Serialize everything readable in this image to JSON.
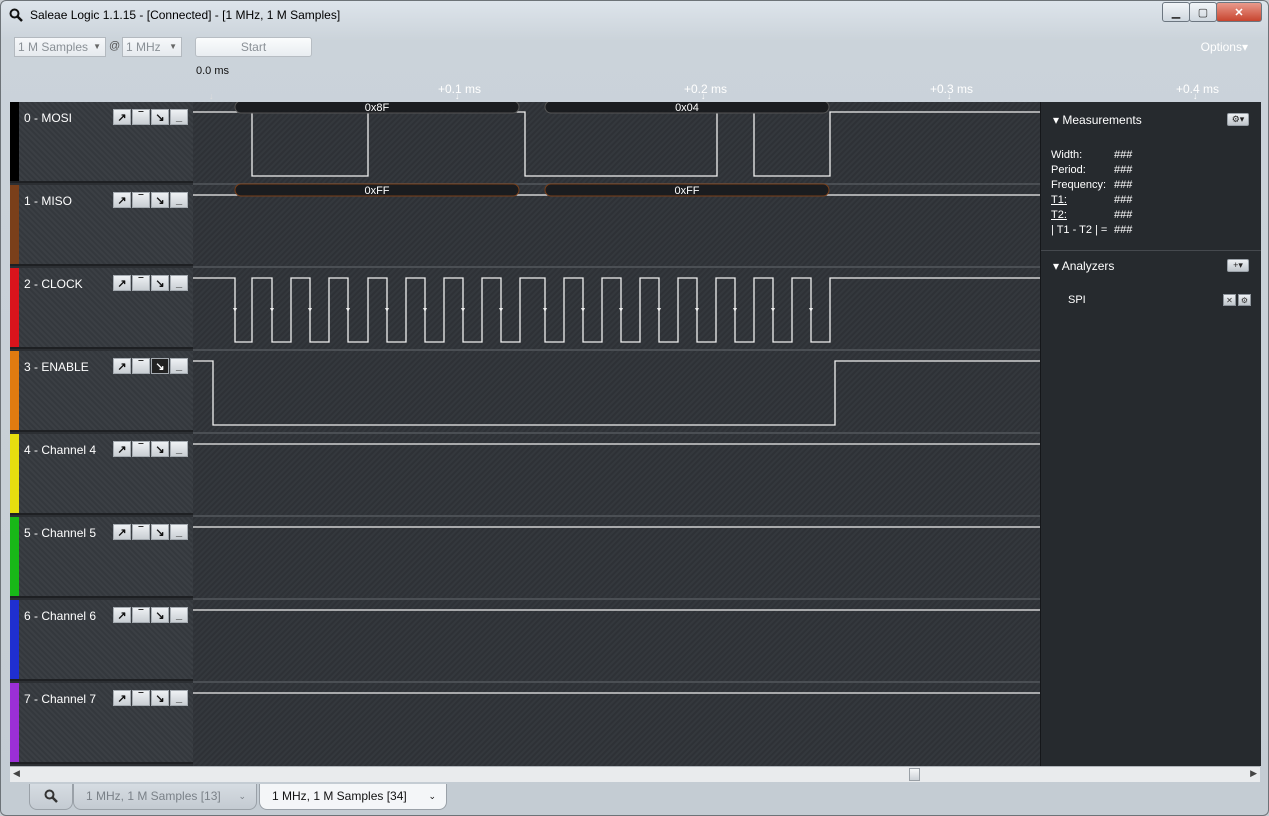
{
  "window": {
    "title": "Saleae Logic 1.1.15 - [Connected] - [1 MHz, 1 M Samples]",
    "minimize_icon": "minimize-icon",
    "maximize_icon": "maximize-icon",
    "close_icon": "close-icon"
  },
  "toolbar": {
    "samples_value": "1 M Samples",
    "at_symbol": "@",
    "rate_value": "1 MHz",
    "start_label": "Start",
    "options_label": "Options▾"
  },
  "timeline": {
    "origin_label": "0.0 ms",
    "ticks": [
      "+0.1 ms",
      "+0.2 ms",
      "+0.3 ms",
      "+0.4 ms"
    ]
  },
  "channels": [
    {
      "label": "0 - MOSI",
      "color": "#000000"
    },
    {
      "label": "1 - MISO",
      "color": "#7a3f1a"
    },
    {
      "label": "2 - CLOCK",
      "color": "#d9141c"
    },
    {
      "label": "3 - ENABLE",
      "color": "#e07b10"
    },
    {
      "label": "4 - Channel 4",
      "color": "#e6de0f"
    },
    {
      "label": "5 - Channel 5",
      "color": "#18b818"
    },
    {
      "label": "6 - Channel 6",
      "color": "#1f2fd0"
    },
    {
      "label": "7 - Channel 7",
      "color": "#9b2fd6"
    }
  ],
  "decoded": {
    "mosi": [
      "0x8F",
      "0x04"
    ],
    "miso": [
      "0xFF",
      "0xFF"
    ]
  },
  "sidebar": {
    "measurements": {
      "header": "Measurements",
      "rows": [
        {
          "label": "Width:",
          "value": "###"
        },
        {
          "label": "Period:",
          "value": "###"
        },
        {
          "label": "Frequency:",
          "value": "###"
        },
        {
          "label": "T1:",
          "value": "###"
        },
        {
          "label": "T2:",
          "value": "###"
        },
        {
          "label": "| T1 - T2 | =",
          "value": "###"
        }
      ]
    },
    "analyzers": {
      "header": "Analyzers",
      "add_label": "+▾",
      "items": [
        "SPI"
      ]
    }
  },
  "tabs": {
    "items": [
      {
        "label": "1 MHz, 1 M Samples [13]"
      },
      {
        "label": "1 MHz, 1 M Samples [34]"
      }
    ]
  }
}
